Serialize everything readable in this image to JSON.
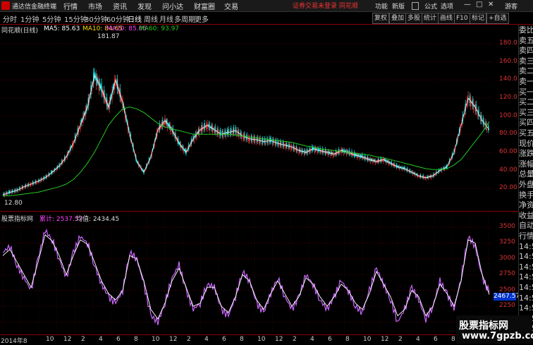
{
  "app": {
    "title": "通达信金融终端"
  },
  "menu": [
    "行情",
    "市场",
    "资讯",
    "发现",
    "问小达",
    "财富圈",
    "交易"
  ],
  "notice": "证券交易未登录  同花顺",
  "topright": [
    "功能",
    "新版",
    "公式",
    "选项"
  ],
  "user": "游客",
  "window_controls": [
    "—",
    "□",
    "✕"
  ],
  "periods": [
    "分时",
    "1分钟",
    "5分钟",
    "15分钟",
    "30分钟",
    "60分钟",
    "日线",
    "周线",
    "月线",
    "多周期",
    "更多"
  ],
  "active_period": "日线",
  "right_tools": [
    "复权",
    "叠加",
    "多股",
    "统计",
    "画线",
    "F10",
    "标记",
    "+自选"
  ],
  "colors": {
    "ma5": "#ffffff",
    "ma10": "#ffdd00",
    "ma20": "#ff44ff",
    "ma60": "#22cc22",
    "up": "#ff3333",
    "down": "#00ffff",
    "grid": "#8b0000",
    "indicator": "#cc66ff"
  },
  "main_legend": {
    "name": "同花顺(日线)",
    "ma5": "MA5: 85.63",
    "ma10": "MA10: 84.65",
    "ma20": "MA20: 85.06",
    "ma60": "MA60: 93.97"
  },
  "ind_legend": {
    "name": "股票指标网",
    "sum": "累计: 2537.57",
    "avg": "均值: 2434.45"
  },
  "price_high_label": "181.87",
  "price_low_label": "12.80",
  "last_value": "2467.57",
  "side_labels": [
    "委比",
    "卖五",
    "卖四",
    "卖三",
    "卖二",
    "卖一",
    "买一",
    "买二",
    "买三",
    "买四",
    "买五",
    "现价",
    "涨跌",
    "涨幅",
    "总量",
    "外盘",
    "换手",
    "净资",
    "收益",
    "自动",
    "行情",
    "14:50",
    "14:50",
    "14:50",
    "14:50",
    "14:50",
    "14:50",
    "14:50",
    "14:50",
    "14:50"
  ],
  "watermark": {
    "line1": "股票指标网",
    "line2": "www.7gpzb.com"
  },
  "dates": [
    "2014年8",
    "10",
    "12",
    "2",
    "4",
    "6",
    "8",
    "10",
    "12",
    "2",
    "4",
    "6",
    "8",
    "10",
    "12",
    "2",
    "4",
    "6",
    "8",
    "10",
    "12",
    "2",
    "4",
    "6",
    "8",
    "10",
    "12"
  ],
  "chart_data": [
    {
      "type": "line",
      "title": "同花顺(日线)",
      "ylim": [
        0,
        190
      ],
      "y_ticks": [
        20.0,
        40.0,
        60.0,
        80.0,
        100.0,
        120.0,
        140.0,
        160.0,
        180.0
      ],
      "x": [
        0,
        1,
        2,
        3,
        4,
        5,
        6,
        7,
        8,
        9,
        10,
        11,
        12,
        13,
        14,
        15,
        16,
        17,
        18,
        19,
        20,
        21,
        22,
        23,
        24,
        25,
        26,
        27,
        28,
        29,
        30,
        31,
        32,
        33,
        34,
        35,
        36,
        37,
        38,
        39,
        40,
        41,
        42,
        43,
        44,
        45,
        46,
        47,
        48,
        49,
        50,
        51,
        52,
        53,
        54,
        55,
        56,
        57,
        58,
        59,
        60,
        61,
        62,
        63,
        64,
        65,
        66,
        67,
        68,
        69
      ],
      "series": [
        {
          "name": "MA5",
          "values": [
            13,
            16,
            18,
            22,
            25,
            28,
            32,
            38,
            45,
            55,
            70,
            90,
            110,
            145,
            130,
            110,
            140,
            115,
            80,
            50,
            38,
            55,
            85,
            95,
            85,
            70,
            60,
            75,
            85,
            90,
            85,
            80,
            82,
            84,
            78,
            75,
            74,
            72,
            73,
            70,
            68,
            66,
            62,
            60,
            64,
            62,
            60,
            58,
            62,
            60,
            57,
            55,
            52,
            50,
            52,
            48,
            44,
            42,
            38,
            34,
            32,
            34,
            40,
            44,
            60,
            90,
            120,
            110,
            95,
            85
          ]
        },
        {
          "name": "MA60",
          "values": [
            12,
            12,
            13,
            14,
            15,
            16,
            18,
            20,
            22,
            25,
            30,
            38,
            48,
            60,
            75,
            90,
            100,
            108,
            110,
            108,
            104,
            98,
            92,
            88,
            86,
            84,
            82,
            80,
            80,
            80,
            80,
            80,
            80,
            79,
            78,
            77,
            76,
            75,
            74,
            73,
            72,
            71,
            69,
            67,
            66,
            64,
            63,
            62,
            61,
            60,
            59,
            58,
            57,
            55,
            54,
            52,
            50,
            48,
            46,
            44,
            42,
            41,
            41,
            42,
            46,
            52,
            62,
            72,
            82,
            94
          ]
        }
      ]
    },
    {
      "type": "line",
      "title": "股票指标网",
      "ylim": [
        1850,
        3600
      ],
      "y_ticks": [
        2000,
        2250,
        2500,
        2750,
        3000,
        3250,
        3500
      ],
      "x": [
        0,
        1,
        2,
        3,
        4,
        5,
        6,
        7,
        8,
        9,
        10,
        11,
        12,
        13,
        14,
        15,
        16,
        17,
        18,
        19,
        20,
        21,
        22,
        23,
        24,
        25,
        26,
        27,
        28,
        29,
        30,
        31,
        32,
        33,
        34,
        35,
        36,
        37,
        38,
        39,
        40,
        41,
        42,
        43,
        44,
        45,
        46,
        47,
        48,
        49,
        50,
        51,
        52,
        53,
        54,
        55,
        56,
        57,
        58,
        59,
        60,
        61,
        62,
        63,
        64,
        65,
        66,
        67,
        68,
        69
      ],
      "series": [
        {
          "name": "累计",
          "values": [
            3100,
            3200,
            2900,
            2700,
            2500,
            3000,
            3450,
            3300,
            3000,
            2700,
            3100,
            3350,
            3250,
            2900,
            2600,
            2400,
            2300,
            2500,
            3100,
            3000,
            2600,
            2100,
            2000,
            2300,
            2700,
            2900,
            2500,
            2200,
            2300,
            2600,
            2550,
            2200,
            2100,
            2400,
            2800,
            2650,
            2300,
            2150,
            2450,
            2700,
            2400,
            2200,
            2400,
            2750,
            2600,
            2350,
            2200,
            2400,
            2650,
            2500,
            2250,
            2150,
            2500,
            2850,
            2600,
            2350,
            2000,
            2200,
            2550,
            2350,
            2050,
            2250,
            2650,
            2450,
            2200,
            2700,
            3350,
            3200,
            2700,
            2467.57
          ]
        },
        {
          "name": "均值",
          "values": [
            3050,
            3150,
            2950,
            2750,
            2550,
            2950,
            3380,
            3280,
            3050,
            2750,
            3050,
            3300,
            3230,
            2950,
            2650,
            2450,
            2350,
            2500,
            3050,
            3000,
            2650,
            2200,
            2050,
            2300,
            2650,
            2850,
            2550,
            2250,
            2300,
            2550,
            2550,
            2250,
            2150,
            2400,
            2750,
            2650,
            2350,
            2200,
            2450,
            2650,
            2450,
            2250,
            2400,
            2700,
            2600,
            2400,
            2250,
            2400,
            2600,
            2500,
            2300,
            2200,
            2450,
            2800,
            2600,
            2400,
            2100,
            2200,
            2500,
            2400,
            2100,
            2250,
            2600,
            2450,
            2250,
            2650,
            3300,
            3250,
            2750,
            2434.45
          ]
        }
      ]
    }
  ]
}
